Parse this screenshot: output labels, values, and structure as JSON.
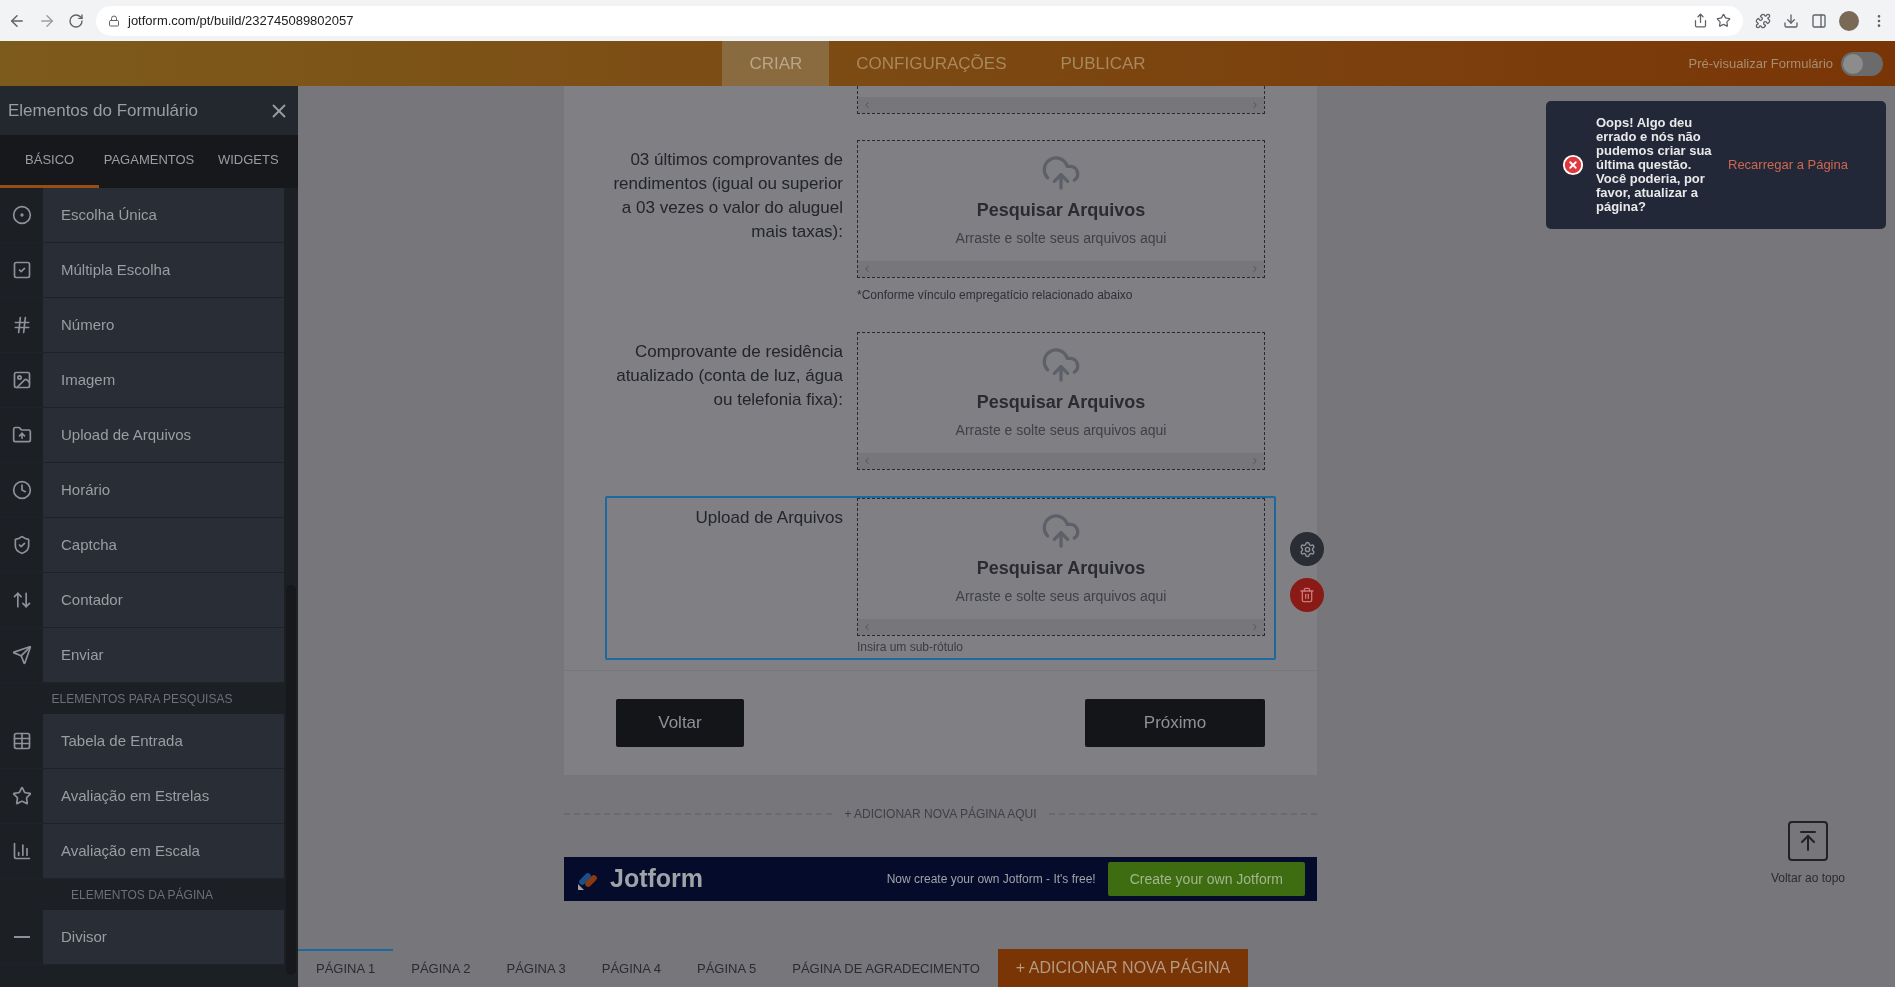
{
  "browser": {
    "url": "jotform.com/pt/build/232745089802057"
  },
  "topbar": {
    "tabs": [
      {
        "label": "CRIAR",
        "selected": true
      },
      {
        "label": "CONFIGURAÇÕES",
        "selected": false
      },
      {
        "label": "PUBLICAR",
        "selected": false
      }
    ],
    "preview": {
      "label": "Pré-visualizar Formulário",
      "on": false
    }
  },
  "sidebar": {
    "title": "Elementos do Formulário",
    "tabs": [
      {
        "label": "BÁSICO",
        "selected": true
      },
      {
        "label": "PAGAMENTOS",
        "selected": false
      },
      {
        "label": "WIDGETS",
        "selected": false
      }
    ],
    "elements": [
      {
        "kind": "item",
        "label": "Escolha Única"
      },
      {
        "kind": "item",
        "label": "Múltipla Escolha"
      },
      {
        "kind": "item",
        "label": "Número"
      },
      {
        "kind": "item",
        "label": "Imagem"
      },
      {
        "kind": "item",
        "label": "Upload de Arquivos"
      },
      {
        "kind": "item",
        "label": "Horário"
      },
      {
        "kind": "item",
        "label": "Captcha"
      },
      {
        "kind": "item",
        "label": "Contador"
      },
      {
        "kind": "item",
        "label": "Enviar"
      },
      {
        "kind": "heading",
        "label": "ELEMENTOS PARA PESQUISAS"
      },
      {
        "kind": "item",
        "label": "Tabela de Entrada"
      },
      {
        "kind": "item",
        "label": "Avaliação em Estrelas"
      },
      {
        "kind": "item",
        "label": "Avaliação em Escala"
      },
      {
        "kind": "heading",
        "label": "ELEMENTOS DA PÁGINA"
      },
      {
        "kind": "item",
        "label": "Divisor"
      }
    ]
  },
  "form": {
    "fields": [
      {
        "label": "03 últimos comprovantes de rendimentos (igual ou superior a 03 vezes o valor do aluguel mais taxas):",
        "button": "Pesquisar Arquivos",
        "hint": "Arraste e solte seus arquivos aqui",
        "note": "*Conforme vínculo empregatício relacionado abaixo",
        "selected": false
      },
      {
        "label": "Comprovante de residência atualizado (conta de luz, água ou telefonia fixa):",
        "button": "Pesquisar Arquivos",
        "hint": "Arraste e solte seus arquivos aqui",
        "selected": false
      },
      {
        "label": "Upload de Arquivos",
        "button": "Pesquisar Arquivos",
        "hint": "Arraste e solte seus arquivos aqui",
        "placeholder": "Insira um sub-rótulo",
        "selected": true
      }
    ],
    "back": "Voltar",
    "next": "Próximo"
  },
  "add_page_here": "+ ADICIONAR NOVA PÁGINA AQUI",
  "banner": {
    "brand": "Jotform",
    "tagline": "Now create your own Jotform - It's free!",
    "cta": "Create your own Jotform"
  },
  "toast": {
    "message": "Oops! Algo deu errado e nós não pudemos criar sua última questão. Você poderia, por favor, atualizar a página?",
    "action": "Recarregar a Página"
  },
  "scroll_top": {
    "label": "Voltar ao topo"
  },
  "page_tabs": [
    {
      "label": "PÁGINA 1",
      "selected": true
    },
    {
      "label": "PÁGINA 2",
      "selected": false
    },
    {
      "label": "PÁGINA 3",
      "selected": false
    },
    {
      "label": "PÁGINA 4",
      "selected": false
    },
    {
      "label": "PÁGINA 5",
      "selected": false
    },
    {
      "label": "PÁGINA DE AGRADECIMENTO",
      "selected": false
    }
  ],
  "add_page": "+ ADICIONAR NOVA PÁGINA"
}
